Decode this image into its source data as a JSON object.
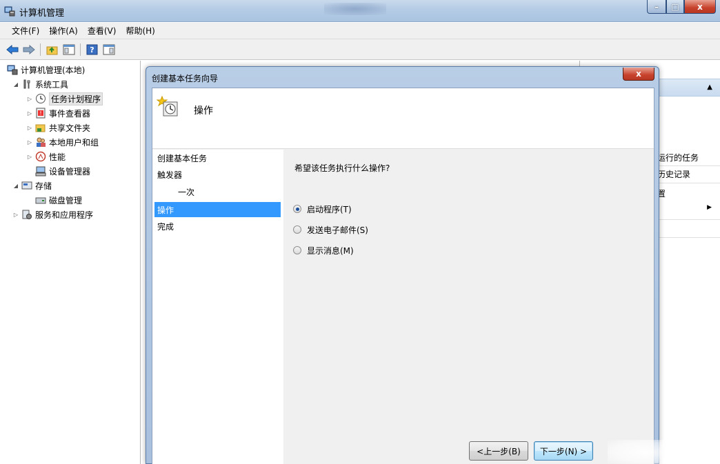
{
  "window": {
    "title": "计算机管理",
    "controls": {
      "minimize": "–",
      "maximize": "□",
      "close": "x"
    }
  },
  "menu": [
    "文件(F)",
    "操作(A)",
    "查看(V)",
    "帮助(H)"
  ],
  "tree": {
    "root": "计算机管理(本地)",
    "items": [
      {
        "label": "系统工具",
        "expanded": true,
        "level": 1
      },
      {
        "label": "任务计划程序",
        "level": 2,
        "selected": true
      },
      {
        "label": "事件查看器",
        "level": 2
      },
      {
        "label": "共享文件夹",
        "level": 2
      },
      {
        "label": "本地用户和组",
        "level": 2
      },
      {
        "label": "性能",
        "level": 2
      },
      {
        "label": "设备管理器",
        "level": 2
      },
      {
        "label": "存储",
        "expanded": true,
        "level": 1
      },
      {
        "label": "磁盘管理",
        "level": 2
      },
      {
        "label": "服务和应用程序",
        "level": 1
      }
    ]
  },
  "actions": {
    "items": [
      "运行的任务",
      "历史记录",
      "置"
    ]
  },
  "dialog": {
    "title": "创建基本任务向导",
    "close": "x",
    "header_title": "操作",
    "steps": [
      {
        "label": "创建基本任务"
      },
      {
        "label": "触发器"
      },
      {
        "label": "一次",
        "sub": true
      },
      {
        "label": "操作",
        "active": true
      },
      {
        "label": "完成"
      }
    ],
    "question": "希望该任务执行什么操作?",
    "options": [
      {
        "label": "启动程序(T)",
        "checked": true
      },
      {
        "label": "发送电子邮件(S)",
        "checked": false
      },
      {
        "label": "显示消息(M)",
        "checked": false
      }
    ],
    "buttons": {
      "back": "<上一步(B)",
      "next": "下一步(N) >"
    }
  }
}
